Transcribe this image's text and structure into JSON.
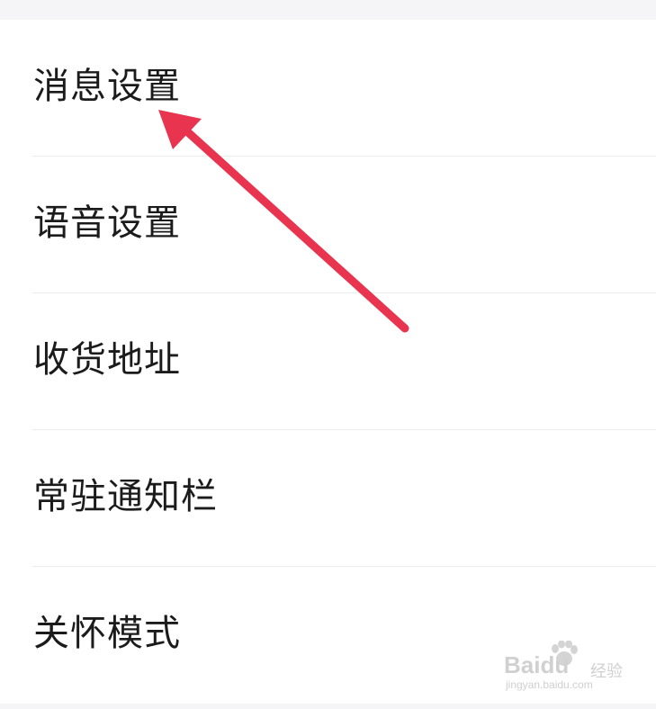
{
  "menu": {
    "items": [
      {
        "label": "消息设置"
      },
      {
        "label": "语音设置"
      },
      {
        "label": "收货地址"
      },
      {
        "label": "常驻通知栏"
      },
      {
        "label": "关怀模式"
      }
    ]
  },
  "annotation": {
    "arrow_color": "#e8344e",
    "arrow_target": "消息设置"
  },
  "watermark": {
    "brand": "Baidu",
    "sub": "经验",
    "url": "jingyan.baidu.com"
  }
}
